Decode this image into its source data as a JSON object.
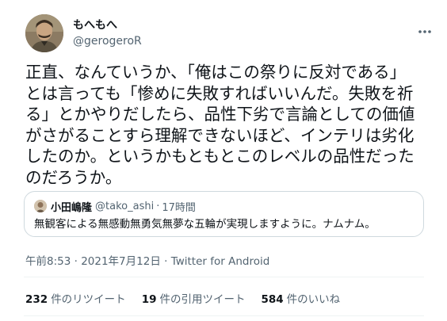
{
  "author": {
    "display_name": "もへもへ",
    "handle": "@gerogeroR",
    "avatar_icon": "user-avatar-portrait"
  },
  "tweet": {
    "lines": [
      "正直、なんていうか、「俺はこの祭りに反対である」",
      "とは言っても「惨めに失敗すればいいんだ。失敗を祈",
      "る」とかやりだしたら、品性下劣で言論としての価値",
      "がさがることすら理解できないほど、インテリは劣化",
      "したのか。というかもともとこのレベルの品性だった",
      "のだろうか。"
    ]
  },
  "quote": {
    "name": "小田嶋隆",
    "handle": "@tako_ashi",
    "separator": "·",
    "time": "17時間",
    "text": "無観客による無感動無勇気無夢な五輪が実現しますように。ナムナム。"
  },
  "meta": {
    "time": "午前8:53",
    "separator1": " · ",
    "date": "2021年7月12日",
    "separator2": " · ",
    "source": "Twitter for Android"
  },
  "stats": {
    "retweets": {
      "count": "232",
      "label": "件のリツイート"
    },
    "quotes": {
      "count": "19",
      "label": "件の引用ツイート"
    },
    "likes": {
      "count": "584",
      "label": "件のいいね"
    }
  },
  "colors": {
    "text": "#0f1419",
    "secondary": "#536471",
    "border": "#cfd9de"
  }
}
